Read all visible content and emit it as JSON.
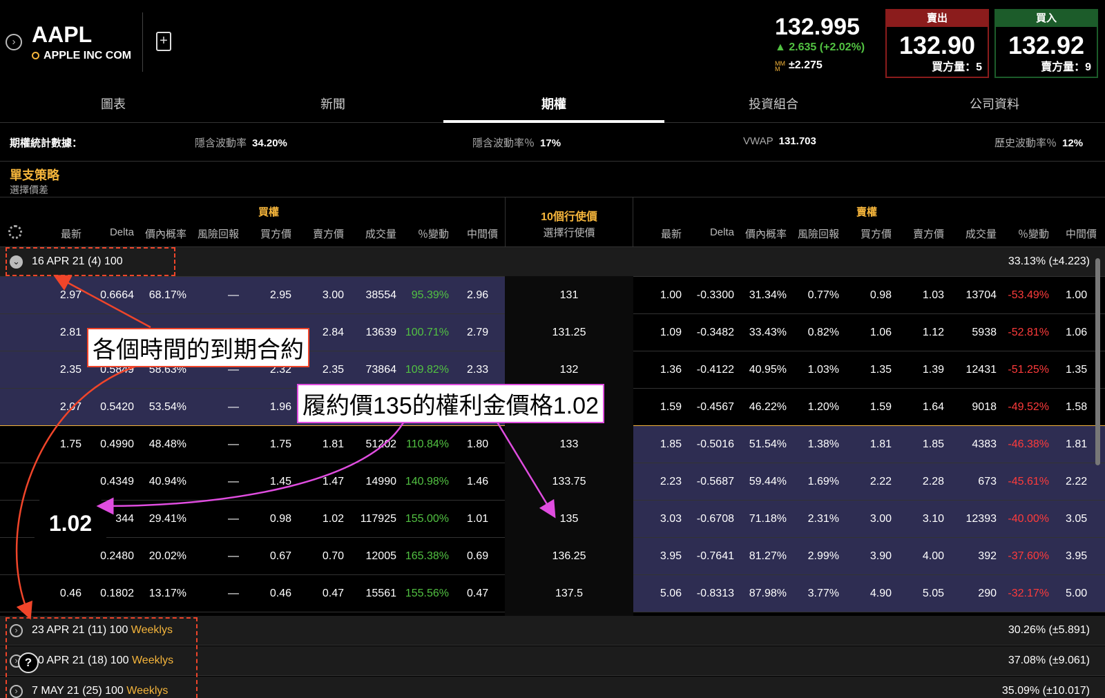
{
  "symbol": {
    "ticker": "AAPL",
    "name": "APPLE INC COM"
  },
  "quote": {
    "last": "132.995",
    "change": "▲ 2.635 (+2.02%)",
    "mm": "±2.275"
  },
  "sell": {
    "label": "賣出",
    "price": "132.90",
    "size": "買方量：5"
  },
  "buy": {
    "label": "買入",
    "price": "132.92",
    "size": "賣方量：9"
  },
  "tabs": [
    "圖表",
    "新聞",
    "期權",
    "投資組合",
    "公司資料"
  ],
  "active_tab": 2,
  "stats": {
    "title": "期權統計數據：",
    "iv_label": "隱含波動率",
    "iv": "34.20%",
    "ivpct_label": "隱含波動率％",
    "ivpct": "17%",
    "vwap_label": "VWAP",
    "vwap": "131.703",
    "hv_label": "歷史波動率％",
    "hv": "12%"
  },
  "strategy": {
    "title": "單支策略",
    "subtitle": "選擇價差"
  },
  "header": {
    "calls": "買權",
    "puts": "賣權",
    "strikes_top": "10個行使價",
    "strikes_bottom": "選擇行使價",
    "cols": [
      "最新",
      "Delta",
      "價內概率",
      "風險回報",
      "買方價",
      "賣方價",
      "成交量",
      "％變動",
      "中間價"
    ]
  },
  "expiries": [
    {
      "label": "16 APR 21 (4) 100",
      "weekly": "",
      "iv": "33.13% (±4.223)"
    },
    {
      "label": "23 APR 21 (11) 100 ",
      "weekly": "Weeklys",
      "iv": "30.26% (±5.891)"
    },
    {
      "label": "30 APR 21 (18) 100 ",
      "weekly": "Weeklys",
      "iv": "37.08% (±9.061)"
    },
    {
      "label": "7 MAY 21 (25) 100 ",
      "weekly": "Weeklys",
      "iv": "35.09% (±10.017)"
    }
  ],
  "rows": [
    {
      "strike": "131",
      "c": [
        "2.97",
        "0.6664",
        "68.17%",
        "—",
        "2.95",
        "3.00",
        "38554",
        "95.39%",
        "2.96"
      ],
      "p": [
        "1.00",
        "-0.3300",
        "31.34%",
        "0.77%",
        "0.98",
        "1.03",
        "13704",
        "-53.49%",
        "1.00"
      ]
    },
    {
      "strike": "131.25",
      "c": [
        "2.81",
        "",
        "",
        "",
        "",
        "2.84",
        "13639",
        "100.71%",
        "2.79"
      ],
      "p": [
        "1.09",
        "-0.3482",
        "33.43%",
        "0.82%",
        "1.06",
        "1.12",
        "5938",
        "-52.81%",
        "1.06"
      ]
    },
    {
      "strike": "132",
      "c": [
        "2.35",
        "0.5849",
        "58.63%",
        "—",
        "2.32",
        "2.35",
        "73864",
        "109.82%",
        "2.33"
      ],
      "p": [
        "1.36",
        "-0.4122",
        "40.95%",
        "1.03%",
        "1.35",
        "1.39",
        "12431",
        "-51.25%",
        "1.35"
      ]
    },
    {
      "strike": "",
      "c": [
        "2.07",
        "0.5420",
        "53.54%",
        "—",
        "1.96",
        "",
        "",
        "",
        ""
      ],
      "p": [
        "1.59",
        "-0.4567",
        "46.22%",
        "1.20%",
        "1.59",
        "1.64",
        "9018",
        "-49.52%",
        "1.58"
      ]
    },
    {
      "strike": "133",
      "c": [
        "1.75",
        "0.4990",
        "48.48%",
        "—",
        "1.75",
        "1.81",
        "51202",
        "110.84%",
        "1.80"
      ],
      "p": [
        "1.85",
        "-0.5016",
        "51.54%",
        "1.38%",
        "1.81",
        "1.85",
        "4383",
        "-46.38%",
        "1.81"
      ]
    },
    {
      "strike": "133.75",
      "c": [
        "",
        "0.4349",
        "40.94%",
        "—",
        "1.45",
        "1.47",
        "14990",
        "140.98%",
        "1.46"
      ],
      "p": [
        "2.23",
        "-0.5687",
        "59.44%",
        "1.69%",
        "2.22",
        "2.28",
        "673",
        "-45.61%",
        "2.22"
      ]
    },
    {
      "strike": "135",
      "c": [
        "",
        "344",
        "29.41%",
        "—",
        "0.98",
        "1.02",
        "117925",
        "155.00%",
        "1.01"
      ],
      "p": [
        "3.03",
        "-0.6708",
        "71.18%",
        "2.31%",
        "3.00",
        "3.10",
        "12393",
        "-40.00%",
        "3.05"
      ]
    },
    {
      "strike": "136.25",
      "c": [
        "",
        "0.2480",
        "20.02%",
        "—",
        "0.67",
        "0.70",
        "12005",
        "165.38%",
        "0.69"
      ],
      "p": [
        "3.95",
        "-0.7641",
        "81.27%",
        "2.99%",
        "3.90",
        "4.00",
        "392",
        "-37.60%",
        "3.95"
      ]
    },
    {
      "strike": "137.5",
      "c": [
        "0.46",
        "0.1802",
        "13.17%",
        "—",
        "0.46",
        "0.47",
        "15561",
        "155.56%",
        "0.47"
      ],
      "p": [
        "5.06",
        "-0.8313",
        "87.98%",
        "3.77%",
        "4.90",
        "5.05",
        "290",
        "-32.17%",
        "5.00"
      ]
    }
  ],
  "annotations": {
    "expiry_note": "各個時間的到期合約",
    "premium_note": "履約價135的權利金價格1.02",
    "bubble": "1.02"
  },
  "colors": {
    "accent_orange": "#f5b53b",
    "itm_row": "#2e2d52",
    "positive": "#52c242",
    "negative": "#ff3b3b",
    "sell": "#8b1c1c",
    "buy": "#1c5c2a",
    "annotation_red": "#f0452a",
    "annotation_magenta": "#e04de0"
  }
}
